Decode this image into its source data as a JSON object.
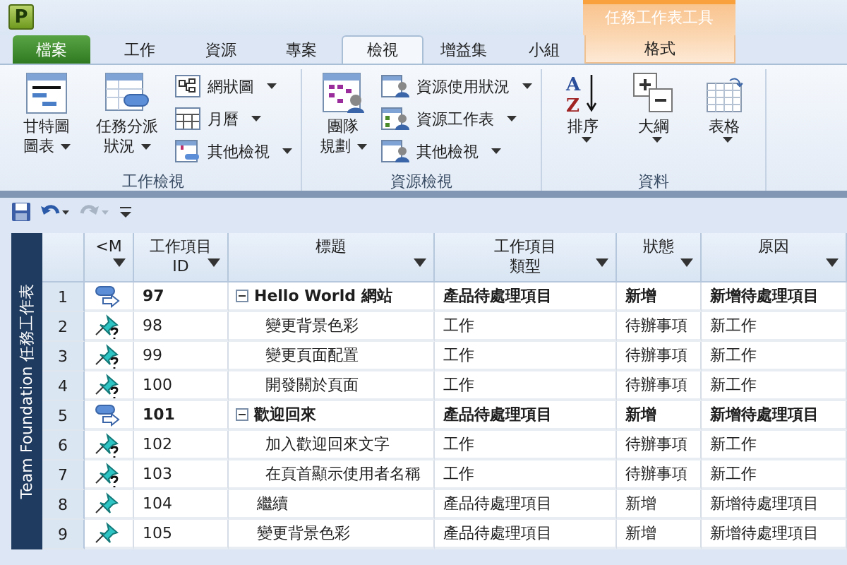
{
  "app_logo": "P",
  "contextual_group": "任務工作表工具",
  "tabs": [
    {
      "label": "檔案",
      "kind": "file",
      "selected": false
    },
    {
      "label": "工作",
      "kind": "normal",
      "selected": false
    },
    {
      "label": "資源",
      "kind": "normal",
      "selected": false
    },
    {
      "label": "專案",
      "kind": "normal",
      "selected": false
    },
    {
      "label": "檢視",
      "kind": "normal",
      "selected": true
    },
    {
      "label": "增益集",
      "kind": "normal",
      "selected": false
    },
    {
      "label": "小組",
      "kind": "normal",
      "selected": false
    },
    {
      "label": "格式",
      "kind": "contextual",
      "selected": false
    }
  ],
  "ribbon_groups": [
    {
      "label": "工作檢視",
      "large": [
        {
          "lines": [
            "甘特圖",
            "圖表"
          ]
        },
        {
          "lines": [
            "任務分派",
            "狀況"
          ]
        }
      ],
      "small": [
        {
          "label": "網狀圖"
        },
        {
          "label": "月曆"
        },
        {
          "label": "其他檢視"
        }
      ]
    },
    {
      "label": "資源檢視",
      "large": [
        {
          "lines": [
            "團隊",
            "規劃"
          ]
        }
      ],
      "small": [
        {
          "label": "資源使用狀況"
        },
        {
          "label": "資源工作表"
        },
        {
          "label": "其他檢視"
        }
      ]
    },
    {
      "label": "資料",
      "large": [
        {
          "lines": [
            "排序"
          ],
          "icon_letters": [
            "A",
            "Z"
          ]
        },
        {
          "lines": [
            "大綱"
          ]
        },
        {
          "lines": [
            "表格"
          ]
        }
      ]
    }
  ],
  "quick_access": [
    {
      "kind": "save",
      "disabled": false
    },
    {
      "kind": "undo",
      "disabled": false
    },
    {
      "kind": "redo",
      "disabled": true
    },
    {
      "kind": "customize",
      "disabled": false
    }
  ],
  "sheet_label": "Team Foundation 任務工作表",
  "columns": [
    {
      "lines": [
        "<M"
      ]
    },
    {
      "lines": [
        "工作項目",
        "ID"
      ]
    },
    {
      "lines": [
        "標題"
      ]
    },
    {
      "lines": [
        "工作項目",
        "類型"
      ]
    },
    {
      "lines": [
        "狀態"
      ]
    },
    {
      "lines": [
        "原因"
      ]
    }
  ],
  "rows": [
    {
      "number": "1",
      "kind": "summary",
      "id": "97",
      "title": "Hello World 網站",
      "type": "產品待處理項目",
      "state": "新增",
      "reason": "新增待處理項目",
      "expanded": true,
      "children": [
        {
          "number": "2",
          "kind": "manual",
          "id": "98",
          "title": "變更背景色彩",
          "type": "工作",
          "state": "待辦事項",
          "reason": "新工作"
        },
        {
          "number": "3",
          "kind": "manual",
          "id": "99",
          "title": "變更頁面配置",
          "type": "工作",
          "state": "待辦事項",
          "reason": "新工作"
        },
        {
          "number": "4",
          "kind": "manual",
          "id": "100",
          "title": "開發關於頁面",
          "type": "工作",
          "state": "待辦事項",
          "reason": "新工作"
        }
      ]
    },
    {
      "number": "5",
      "kind": "summary",
      "id": "101",
      "title": "歡迎回來",
      "type": "產品待處理項目",
      "state": "新增",
      "reason": "新增待處理項目",
      "expanded": true,
      "children": [
        {
          "number": "6",
          "kind": "manual",
          "id": "102",
          "title": "加入歡迎回來文字",
          "type": "工作",
          "state": "待辦事項",
          "reason": "新工作"
        },
        {
          "number": "7",
          "kind": "manual",
          "id": "103",
          "title": "在頁首顯示使用者名稱",
          "type": "工作",
          "state": "待辦事項",
          "reason": "新工作"
        }
      ]
    },
    {
      "number": "8",
      "kind": "pinned",
      "id": "104",
      "title": "繼續",
      "type": "產品待處理項目",
      "state": "新增",
      "reason": "新增待處理項目"
    },
    {
      "number": "9",
      "kind": "pinned",
      "id": "105",
      "title": "變更背景色彩",
      "type": "產品待處理項目",
      "state": "新增",
      "reason": "新增待處理項目"
    }
  ]
}
